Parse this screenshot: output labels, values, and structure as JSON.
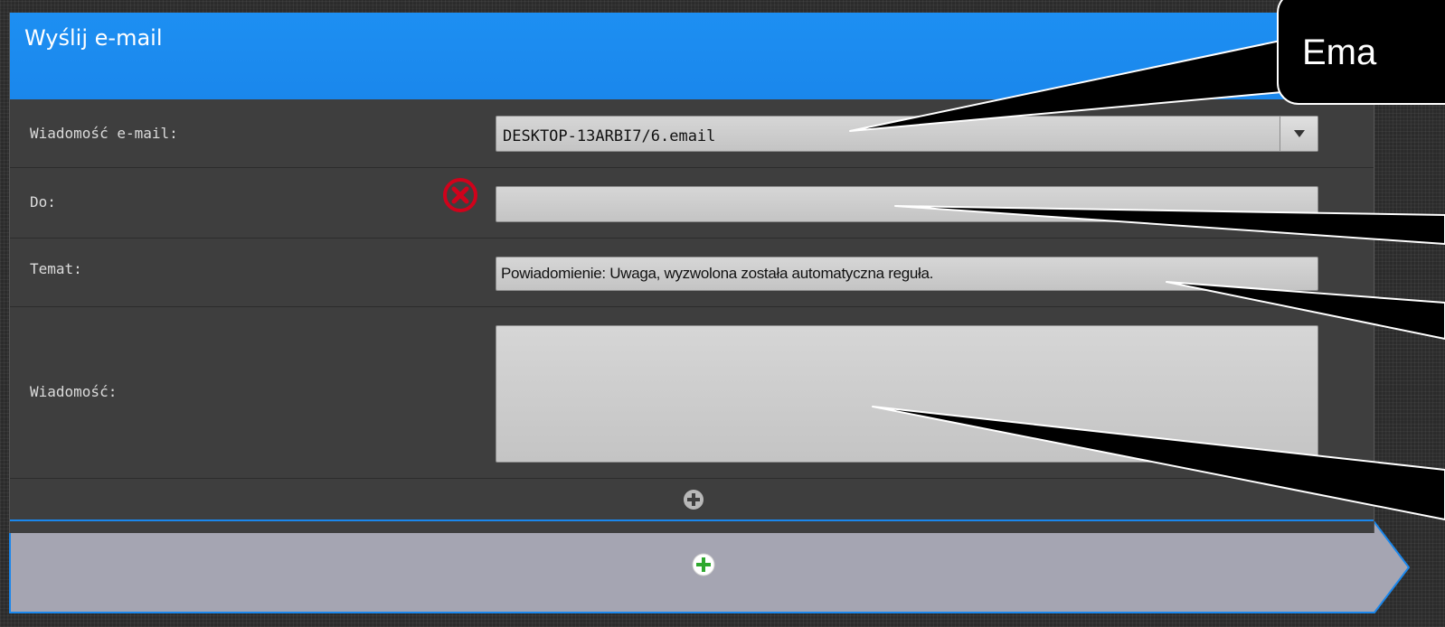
{
  "dialog": {
    "title": "Wyślij e-mail"
  },
  "form": {
    "email_label": "Wiadomość e-mail:",
    "email_value": "DESKTOP-13ARBI7/6.email",
    "to_label": "Do:",
    "to_value": "",
    "subject_label": "Temat:",
    "subject_value": "Powiadomienie: Uwaga, wyzwolona została automatyczna reguła.",
    "message_label": "Wiadomość:",
    "message_value": ""
  },
  "tooltip": {
    "text": "Ema"
  },
  "colors": {
    "header_blue": "#1a87ec",
    "error_red": "#d0021b",
    "add_green": "#2ea82e"
  },
  "icons": {
    "dropdown": "chevron-down-icon",
    "error": "error-circle-x-icon",
    "add_gray": "plus-circle-icon",
    "add_green": "plus-circle-icon"
  }
}
